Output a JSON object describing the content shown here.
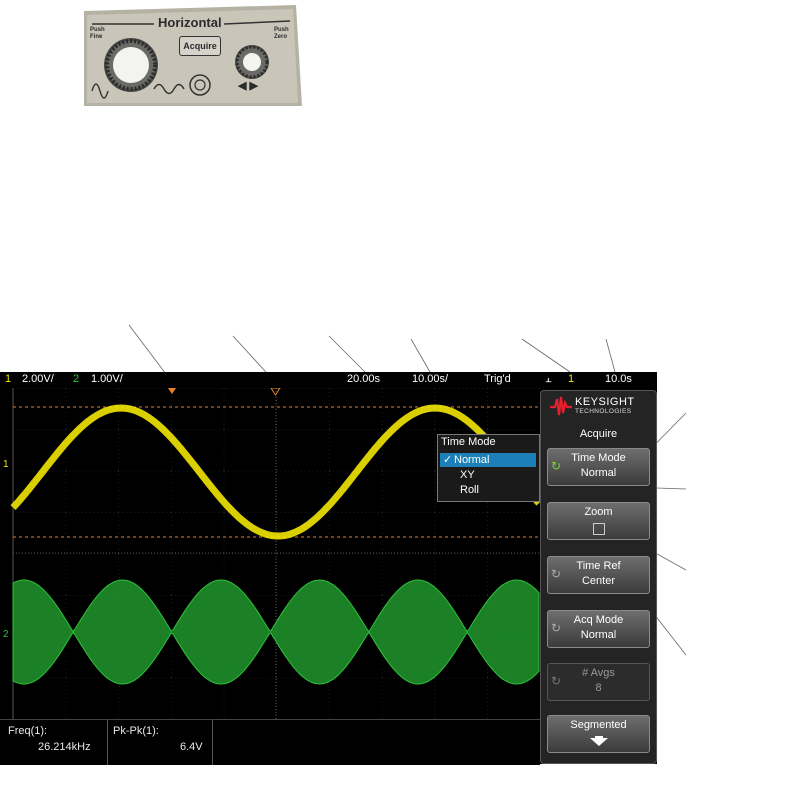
{
  "front_panel": {
    "title": "Horizontal",
    "push_fine": "Push\nFine",
    "push_zero": "Push\nZero",
    "acquire_label": "Acquire",
    "arrows": "◀ ▶"
  },
  "status_bar": {
    "ch1_num": "1",
    "ch1_scale": "2.00V/",
    "ch2_num": "2",
    "ch2_scale": "1.00V/",
    "delay": "20.00s",
    "timebase": "10.00s/",
    "trigger_status": "Trig'd",
    "trigger_slope": "⫠",
    "trigger_source": "1",
    "trigger_level": "10.0s"
  },
  "channel_markers": {
    "ch1": "1",
    "ch2": "2"
  },
  "popup": {
    "title": "Time Mode",
    "options": [
      {
        "label": "Normal",
        "selected": true,
        "mark": "✓"
      },
      {
        "label": "XY",
        "selected": false,
        "mark": ""
      },
      {
        "label": "Roll",
        "selected": false,
        "mark": ""
      }
    ]
  },
  "measurements": [
    {
      "label": "Freq(1):",
      "value": "26.214kHz"
    },
    {
      "label": "Pk-Pk(1):",
      "value": "6.4V"
    }
  ],
  "softkeys": {
    "brand": "KEYSIGHT",
    "brand_sub": "TECHNOLOGIES",
    "menu_title": "Acquire",
    "keys": [
      {
        "line1": "Time Mode",
        "line2": "Normal",
        "icon": "rotate-icon"
      },
      {
        "line1": "Zoom",
        "line2": "",
        "icon": "checkbox-icon"
      },
      {
        "line1": "Time Ref",
        "line2": "Center",
        "icon": "rotate-icon"
      },
      {
        "line1": "Acq Mode",
        "line2": "Normal",
        "icon": "rotate-icon"
      },
      {
        "line1": "# Avgs",
        "line2": "8",
        "icon": "rotate-icon"
      },
      {
        "line1": "Segmented",
        "line2": "",
        "icon": "down-arrow-icon"
      }
    ]
  },
  "colors": {
    "ch1": "#f2e600",
    "ch2": "#2ec23a",
    "trigger": "#e8822a",
    "selection": "#1d7fb7"
  }
}
